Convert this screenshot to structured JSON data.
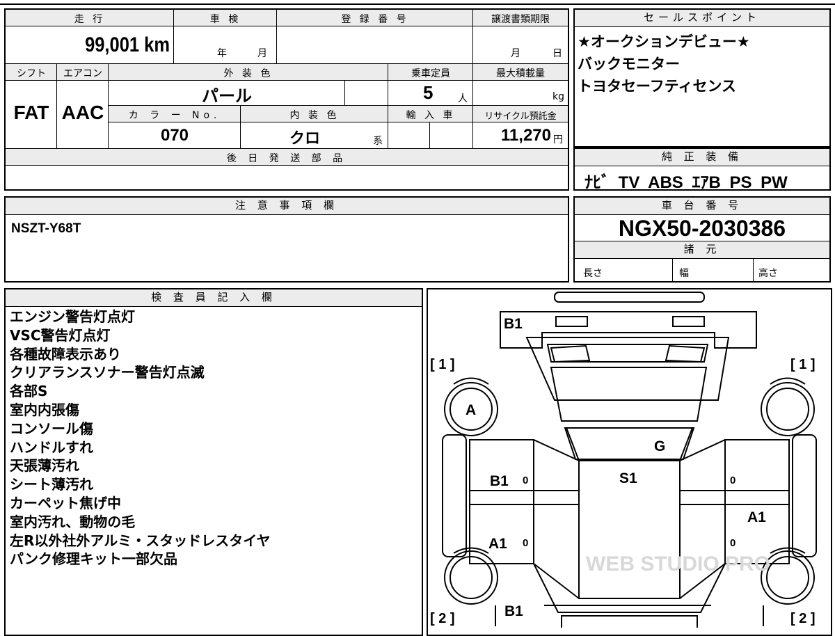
{
  "vehicle": {
    "mileage_header": "走 行",
    "mileage": "99,001 km",
    "shaken_header": "車 検",
    "shaken_year": "年",
    "shaken_month": "月",
    "registration_header": "登 録 番 号",
    "transfer_header": "譲渡書類期限",
    "transfer_month": "月",
    "transfer_day": "日",
    "shift_header": "シフト",
    "shift": "FAT",
    "aircon_header": "エアコン",
    "aircon": "AAC",
    "exterior_header": "外 装 色",
    "exterior": "パール",
    "capacity_header": "乗車定員",
    "capacity": "5",
    "capacity_unit": "人",
    "maxload_header": "最大積載量",
    "maxload_unit": "kg",
    "color_no_header": "カ ラ ー No.",
    "color_no": "070",
    "interior_header": "内 装 色",
    "interior": "クロ",
    "interior_suffix": "系",
    "import_header": "輸 入 車",
    "recycle_header": "リサイクル預託金",
    "recycle": "11,270",
    "recycle_unit": "円",
    "later_parts_header": "後 日 発 送 部 品"
  },
  "sales_point": {
    "header": "セールスポイント",
    "lines": [
      "★オークションデビュー★",
      "バックモニター",
      "トヨタセーフティセンス"
    ]
  },
  "genuine": {
    "header": "純 正 装 備",
    "items": "ﾅﾋﾞ TV ABS ｴｱB PS PW"
  },
  "notes": {
    "header": "注 意 事 項 欄",
    "text": "NSZT-Y68T"
  },
  "chassis": {
    "header": "車 台 番 号",
    "number": "NGX50-2030386",
    "spec_header": "諸 元",
    "length": "長さ",
    "width": "幅",
    "height": "高さ"
  },
  "inspector": {
    "header": "検 査 員 記 入 欄",
    "lines": [
      "エンジン警告灯点灯",
      "VSC警告灯点灯",
      "各種故障表示あり",
      "クリアランスソナー警告灯点滅",
      "各部S",
      "室内内張傷",
      "コンソール傷",
      "ハンドルすれ",
      "天張薄汚れ",
      "シート薄汚れ",
      "カーペット焦げ中",
      "室内汚れ、動物の毛",
      "左R以外社外アルミ・スタッドレスタイヤ",
      "パンク修理キット一部欠品"
    ]
  },
  "diagram": {
    "marks": [
      "B1",
      "A",
      "G",
      "S1",
      "B1",
      "A1",
      "A1",
      "B1"
    ],
    "zero": "0",
    "corner_tl": "[ 1 ]",
    "corner_tr": "[ 1 ]",
    "corner_bl": "[ 2 ]",
    "corner_br": "[ 2 ]",
    "watermark": "WEB STUDIO PRO"
  }
}
